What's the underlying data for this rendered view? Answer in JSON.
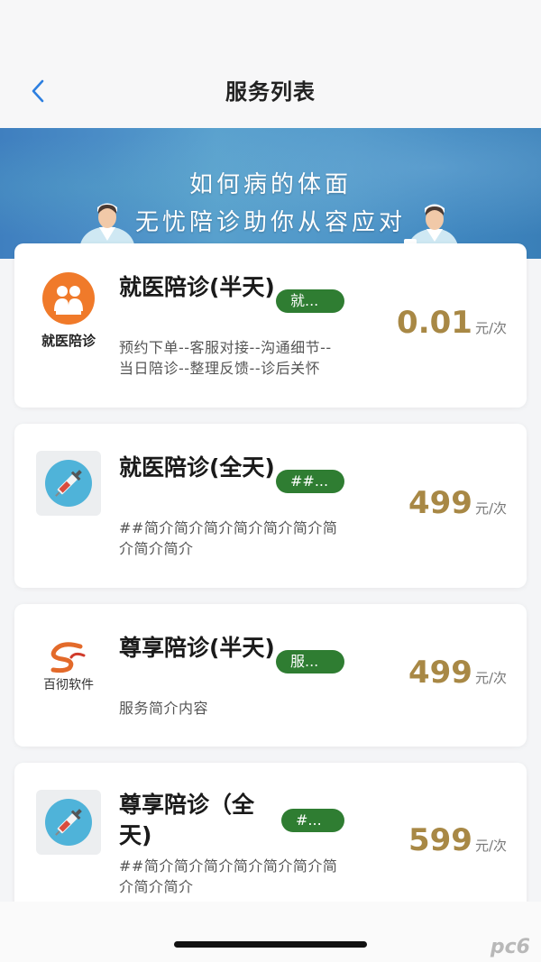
{
  "header": {
    "title": "服务列表"
  },
  "banner": {
    "line1": "如何病的体面",
    "line2": "无忧陪诊助你从容应对"
  },
  "services": [
    {
      "name": "就医陪诊(半天)",
      "tag": "就...",
      "desc": "预约下单--客服对接--沟通细节--当日陪诊--整理反馈--诊后关怀",
      "price": "0.01",
      "unit": "元/次",
      "icon_label": "就医陪诊",
      "icon": "orange-people-logo-icon"
    },
    {
      "name": "就医陪诊(全天)",
      "tag": "##...",
      "desc": "##简介简介简介简介简介简介简介简介简介",
      "price": "499",
      "unit": "元/次",
      "icon": "syringe-icon"
    },
    {
      "name": "尊享陪诊(半天)",
      "tag": "服...",
      "desc": "服务简介内容",
      "price": "499",
      "unit": "元/次",
      "icon_label": "百彻软件",
      "icon": "baiche-software-logo-icon"
    },
    {
      "name": "尊享陪诊（全天)",
      "tag": "#...",
      "desc": "##简介简介简介简介简介简介简介简介简介",
      "price": "599",
      "unit": "元/次",
      "icon": "syringe-icon"
    }
  ],
  "watermark": "pc6",
  "colors": {
    "tag_green": "#2f7d32",
    "price_gold": "#a88845",
    "back_blue": "#2d7fe0"
  }
}
